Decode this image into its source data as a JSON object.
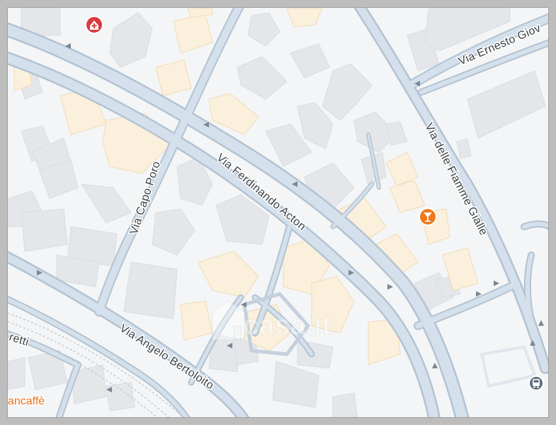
{
  "map": {
    "streets": {
      "via_ernesto": "Via Ernesto Giov",
      "via_fiamme_gialle": "Via delle Fiamme Gialle",
      "via_capo_poro": "Via Capo Poro",
      "via_ferdinando_acton": "Via Ferdinando Acton",
      "via_angelo_bertoloito": "Via Angelo Bertoloito",
      "retti": "retti"
    },
    "pois": {
      "cafe_label": "ancaffè"
    },
    "watermark": "casa.it",
    "icons": {
      "hospital": "hospital-icon",
      "bar": "cocktail-icon",
      "transit": "bus-icon"
    },
    "colors": {
      "background": "#f4f5f6",
      "road": "#b8c8d6",
      "building": "#e4e6ea",
      "building_highlight": "#fbf0dc",
      "poi_red": "#db3a3e",
      "poi_orange": "#f0791c",
      "frame": "#bdbdbd"
    }
  }
}
